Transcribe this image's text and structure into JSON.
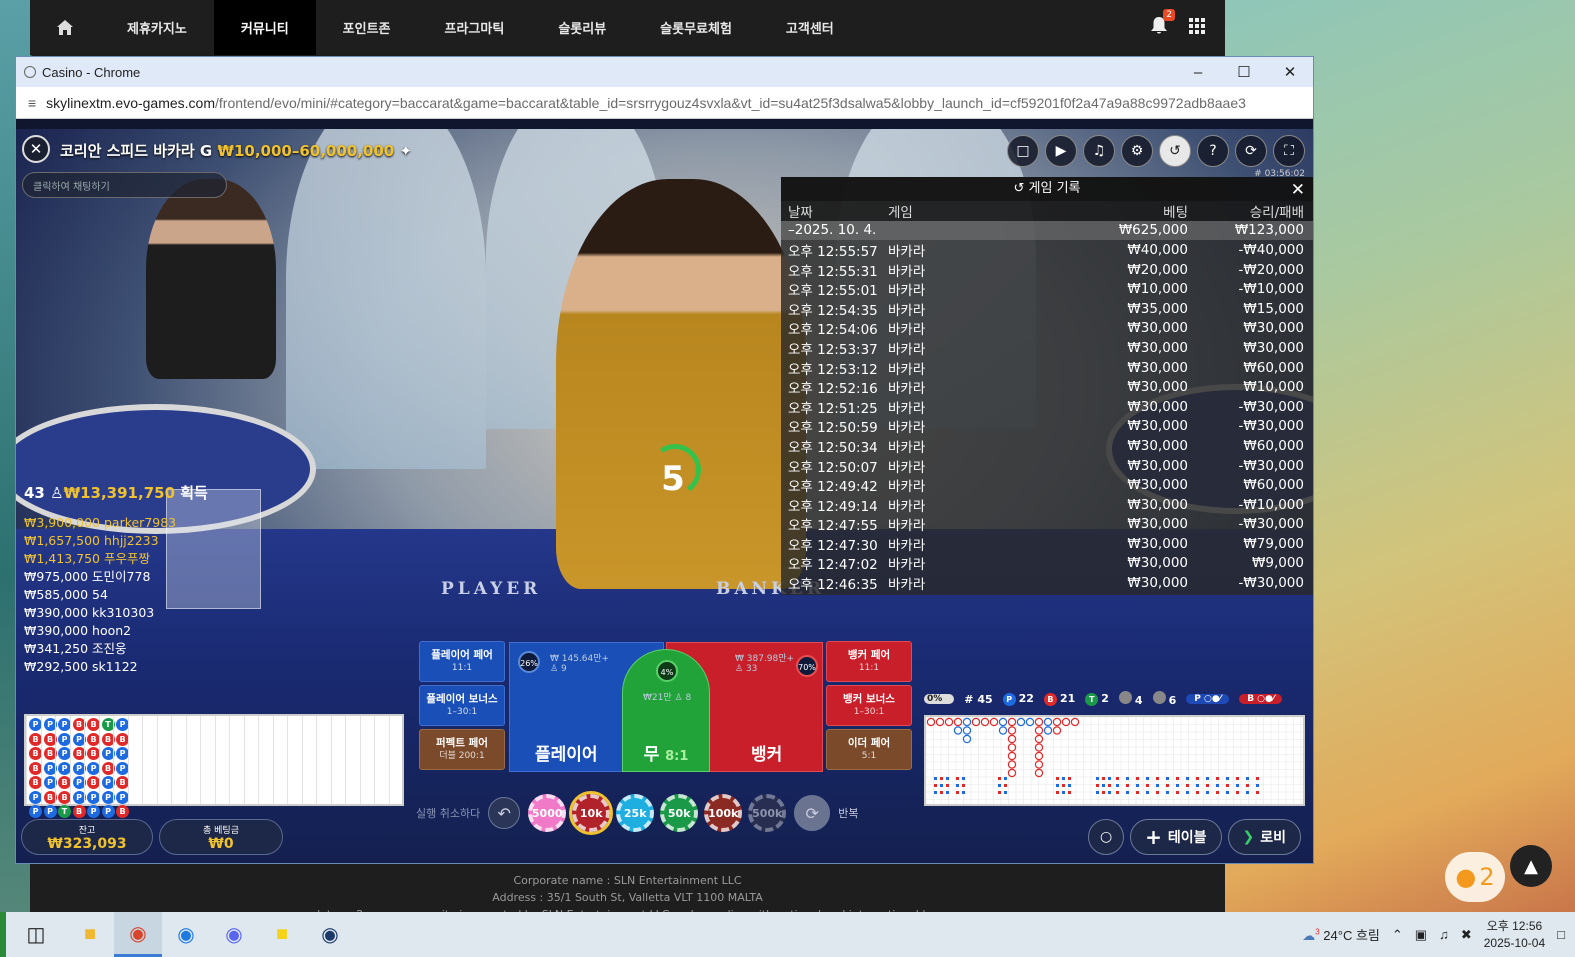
{
  "site_nav": {
    "items": [
      "제휴카지노",
      "커뮤니티",
      "포인트존",
      "프라그마틱",
      "슬롯리뷰",
      "슬롯무료체험",
      "고객센터"
    ],
    "active": "커뮤니티",
    "notification_count": "2"
  },
  "window": {
    "title": "Casino - Chrome"
  },
  "address_bar": {
    "domain": "skylinextm.evo-games.com",
    "path": "/frontend/evo/mini/#category=baccarat&game=baccarat&table_id=srsrrygouz4svxla&vt_id=su4at25f3dsalwa5&lobby_launch_id=cf59201f0f2a47a9a88c9972adb8aae3"
  },
  "game": {
    "title": "코리안 스피드 바카라 G",
    "limits": "₩10,000–60,000,000",
    "chat_placeholder": "클릭하여 채팅하기",
    "game_id": "# 03:56:02",
    "timer": "5",
    "felt_player": "PLAYER",
    "felt_banker": "BANKER"
  },
  "history": {
    "title": "게임 기록",
    "headers": {
      "date": "날짜",
      "game": "게임",
      "bet": "베팅",
      "result": "승리/패배"
    },
    "summary": {
      "date": "–2025. 10. 4.",
      "bet": "₩625,000",
      "result": "₩123,000"
    },
    "rows": [
      {
        "time": "오후 12:55:57",
        "game": "바카라",
        "bet": "₩40,000",
        "result": "-₩40,000"
      },
      {
        "time": "오후 12:55:31",
        "game": "바카라",
        "bet": "₩20,000",
        "result": "-₩20,000"
      },
      {
        "time": "오후 12:55:01",
        "game": "바카라",
        "bet": "₩10,000",
        "result": "-₩10,000"
      },
      {
        "time": "오후 12:54:35",
        "game": "바카라",
        "bet": "₩35,000",
        "result": "₩15,000"
      },
      {
        "time": "오후 12:54:06",
        "game": "바카라",
        "bet": "₩30,000",
        "result": "₩30,000"
      },
      {
        "time": "오후 12:53:37",
        "game": "바카라",
        "bet": "₩30,000",
        "result": "₩30,000"
      },
      {
        "time": "오후 12:53:12",
        "game": "바카라",
        "bet": "₩30,000",
        "result": "₩60,000"
      },
      {
        "time": "오후 12:52:16",
        "game": "바카라",
        "bet": "₩30,000",
        "result": "₩10,000"
      },
      {
        "time": "오후 12:51:25",
        "game": "바카라",
        "bet": "₩30,000",
        "result": "-₩30,000"
      },
      {
        "time": "오후 12:50:59",
        "game": "바카라",
        "bet": "₩30,000",
        "result": "-₩30,000"
      },
      {
        "time": "오후 12:50:34",
        "game": "바카라",
        "bet": "₩30,000",
        "result": "₩60,000"
      },
      {
        "time": "오후 12:50:07",
        "game": "바카라",
        "bet": "₩30,000",
        "result": "-₩30,000"
      },
      {
        "time": "오후 12:49:42",
        "game": "바카라",
        "bet": "₩30,000",
        "result": "₩60,000"
      },
      {
        "time": "오후 12:49:14",
        "game": "바카라",
        "bet": "₩30,000",
        "result": "-₩10,000"
      },
      {
        "time": "오후 12:47:55",
        "game": "바카라",
        "bet": "₩30,000",
        "result": "-₩30,000"
      },
      {
        "time": "오후 12:47:30",
        "game": "바카라",
        "bet": "₩30,000",
        "result": "₩79,000"
      },
      {
        "time": "오후 12:47:02",
        "game": "바카라",
        "bet": "₩30,000",
        "result": "₩9,000"
      },
      {
        "time": "오후 12:46:35",
        "game": "바카라",
        "bet": "₩30,000",
        "result": "-₩30,000"
      }
    ]
  },
  "winners": {
    "count": "43",
    "total": "₩13,391,750",
    "suffix": "획득",
    "list": [
      {
        "amount": "₩3,900,000",
        "name": "parker7983",
        "gold": true
      },
      {
        "amount": "₩1,657,500",
        "name": "hhjj2233",
        "gold": true
      },
      {
        "amount": "₩1,413,750",
        "name": "푸우푸짱",
        "gold": true
      },
      {
        "amount": "₩975,000",
        "name": "도민이778",
        "gold": false
      },
      {
        "amount": "₩585,000",
        "name": "54",
        "gold": false
      },
      {
        "amount": "₩390,000",
        "name": "kk310303",
        "gold": false
      },
      {
        "amount": "₩390,000",
        "name": "hoon2",
        "gold": false
      },
      {
        "amount": "₩341,250",
        "name": "조진웅",
        "gold": false
      },
      {
        "amount": "₩292,500",
        "name": "sk1122",
        "gold": false
      }
    ]
  },
  "bead_road": [
    [
      "P",
      "B",
      "B",
      "B",
      "B",
      "P",
      "P"
    ],
    [
      "P",
      "B",
      "B",
      "P",
      "P",
      "B",
      "P"
    ],
    [
      "P",
      "P",
      "P",
      "P",
      "B",
      "B",
      "T"
    ],
    [
      "B",
      "P",
      "B",
      "P",
      "P",
      "P",
      "B"
    ],
    [
      "B",
      "B",
      "B",
      "P",
      "B",
      "P",
      "P"
    ],
    [
      "T",
      "B",
      "P",
      "B",
      "P",
      "P",
      "P"
    ],
    [
      "P",
      "B",
      "P",
      "P",
      "B",
      "P",
      "B"
    ]
  ],
  "balance": {
    "label": "잔고",
    "value": "₩323,093"
  },
  "total_bet": {
    "label": "총 베팅금",
    "value": "₩0"
  },
  "bets": {
    "player_pair": {
      "label": "플레이어 페어",
      "odds": "11:1"
    },
    "player_bonus": {
      "label": "플레이어 보너스",
      "odds": "1–30:1"
    },
    "perfect_pair": {
      "label": "퍼펙트 페어",
      "odds": "더블 200:1"
    },
    "banker_pair": {
      "label": "뱅커 페어",
      "odds": "11:1"
    },
    "banker_bonus": {
      "label": "뱅커 보너스",
      "odds": "1–30:1"
    },
    "either_pair": {
      "label": "이더 페어",
      "odds": "5:1"
    },
    "player": {
      "label": "플레이어",
      "pct": "26%",
      "pool": "₩ 145.64만+",
      "players": "9"
    },
    "tie": {
      "label": "무",
      "odds": "8:1",
      "pct": "4%",
      "pool": "₩21만",
      "players": "8"
    },
    "banker": {
      "label": "뱅커",
      "pct": "70%",
      "pool": "₩ 387.98만+",
      "players": "33"
    }
  },
  "chips": {
    "undo_label": "실행 취소하다",
    "repeat_label": "반복",
    "values": [
      {
        "label": "5000",
        "color": "#f07ac8"
      },
      {
        "label": "10k",
        "color": "#b2222a"
      },
      {
        "label": "25k",
        "color": "#1eaee0"
      },
      {
        "label": "50k",
        "color": "#1a9a48"
      },
      {
        "label": "100k",
        "color": "#8a2a22"
      },
      {
        "label": "500k",
        "color": "#3a3a4a"
      }
    ]
  },
  "stats": {
    "progress": "0%",
    "rounds": "# 45",
    "player": "22",
    "banker": "21",
    "tie": "2",
    "player_pair": "4",
    "banker_pair": "6"
  },
  "buttons": {
    "table": "테이블",
    "lobby": "로비"
  },
  "footer": {
    "line1": "Corporate name : SLN Entertainment LLC",
    "line2": "Address : 35/1 South St, Valletta VLT 1100 MALTA",
    "line3": "slotnara2.com community is operated by SLN Entertainment LLC and complies with national and international law."
  },
  "taskbar": {
    "weather": "24°C 흐림",
    "weather_badge": "3",
    "time": "오후 12:56",
    "date": "2025-10-04"
  },
  "chat_fab_count": "2"
}
